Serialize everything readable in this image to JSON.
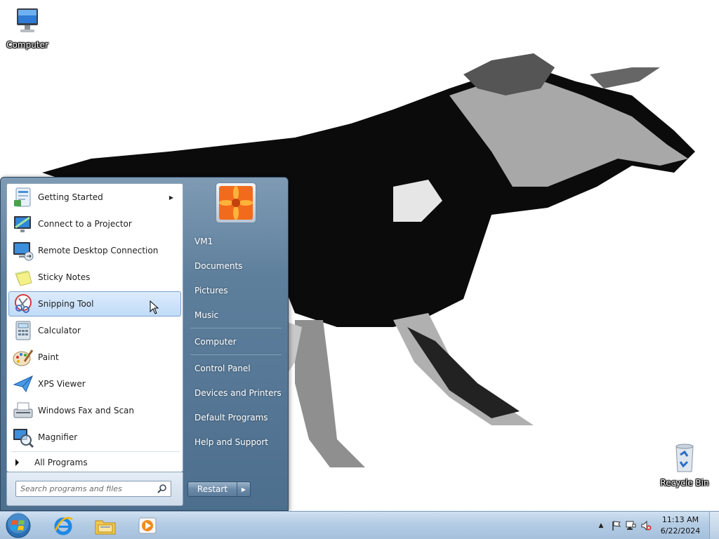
{
  "desktop": {
    "icons": [
      {
        "label": "Computer",
        "icon": "computer-icon"
      },
      {
        "label": "Recycle Bin",
        "icon": "recycle-bin-icon"
      }
    ]
  },
  "start_menu": {
    "programs": [
      {
        "label": "Getting Started",
        "icon": "getting-started-icon",
        "has_submenu": true
      },
      {
        "label": "Connect to a Projector",
        "icon": "projector-icon"
      },
      {
        "label": "Remote Desktop Connection",
        "icon": "remote-desktop-icon"
      },
      {
        "label": "Sticky Notes",
        "icon": "sticky-notes-icon"
      },
      {
        "label": "Snipping Tool",
        "icon": "snipping-tool-icon",
        "selected": true
      },
      {
        "label": "Calculator",
        "icon": "calculator-icon"
      },
      {
        "label": "Paint",
        "icon": "paint-icon"
      },
      {
        "label": "XPS Viewer",
        "icon": "xps-viewer-icon"
      },
      {
        "label": "Windows Fax and Scan",
        "icon": "fax-scan-icon"
      },
      {
        "label": "Magnifier",
        "icon": "magnifier-icon"
      }
    ],
    "all_programs_label": "All Programs",
    "search_placeholder": "Search programs and files",
    "right_links": [
      {
        "label": "VM1"
      },
      {
        "label": "Documents"
      },
      {
        "label": "Pictures"
      },
      {
        "label": "Music"
      },
      {
        "label": "Computer"
      },
      {
        "label": "Control Panel"
      },
      {
        "label": "Devices and Printers"
      },
      {
        "label": "Default Programs"
      },
      {
        "label": "Help and Support"
      }
    ],
    "power_button_label": "Restart"
  },
  "taskbar": {
    "pinned": [
      {
        "icon": "internet-explorer-icon"
      },
      {
        "icon": "file-explorer-icon"
      },
      {
        "icon": "media-player-icon"
      }
    ],
    "tray": {
      "time": "11:13 AM",
      "date": "6/22/2024",
      "icons": [
        "show-hidden-icons-icon",
        "action-center-flag-icon",
        "network-icon",
        "volume-muted-icon"
      ]
    }
  },
  "colors": {
    "selection_bg": "#c1dcf8",
    "start_menu_frame": "#5e7f9c",
    "taskbar": "#b4cce4"
  }
}
